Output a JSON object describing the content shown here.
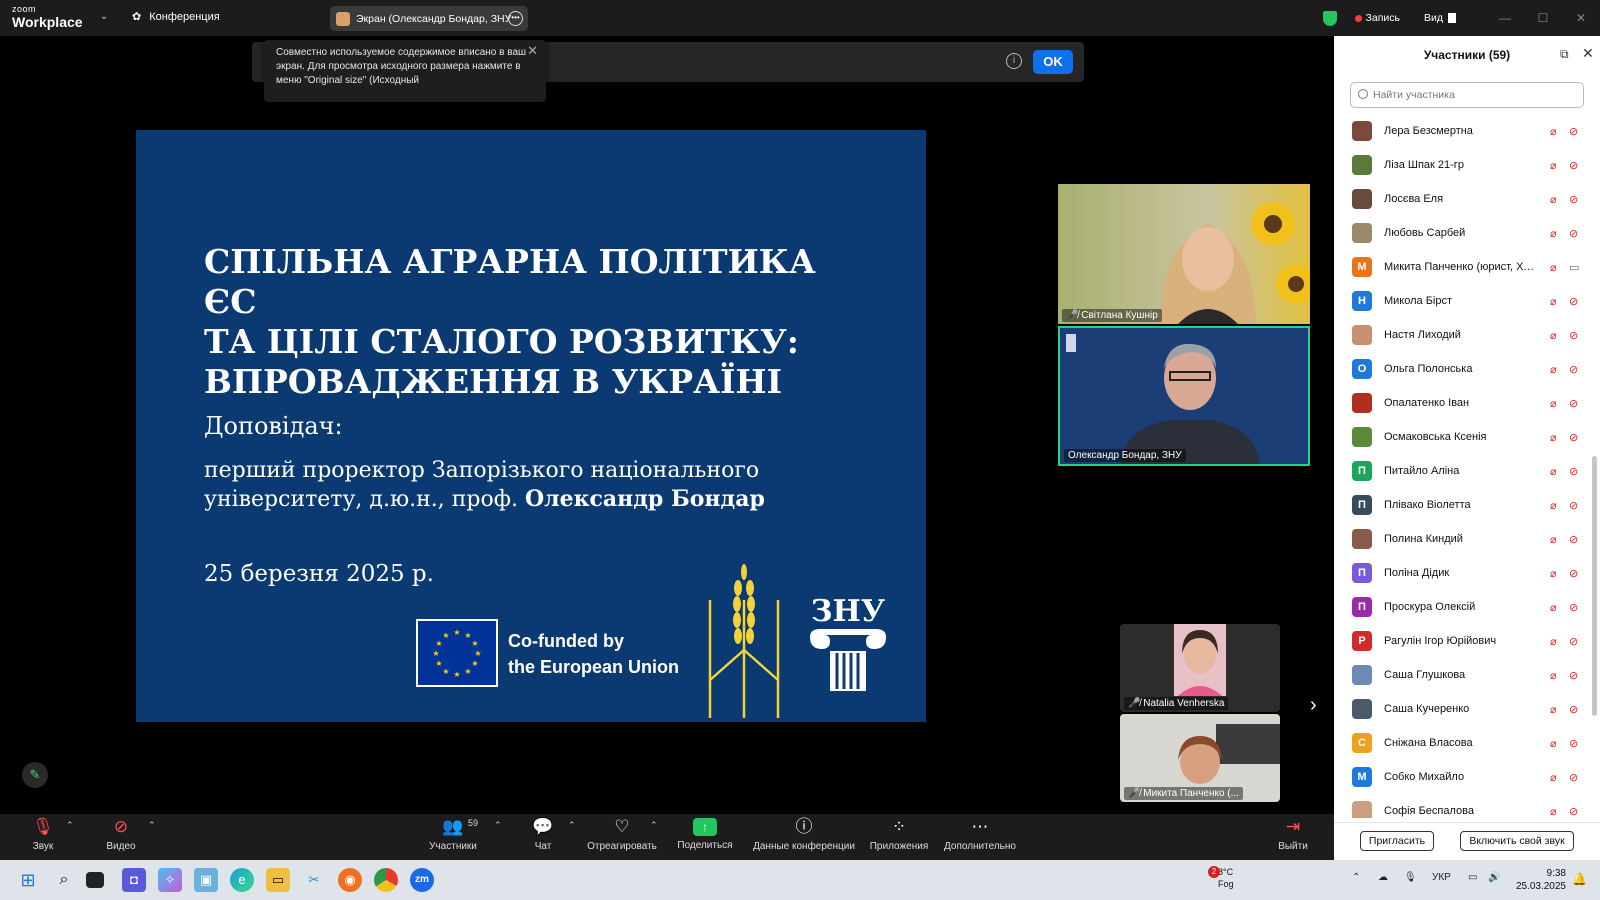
{
  "topbar": {
    "logo_small": "zoom",
    "logo_big": "Workplace",
    "meeting_tab": "Конференция",
    "screen_share_label": "Экран (Олександр Бондар, ЗНУ",
    "record_label": "Запись",
    "view_label": "Вид"
  },
  "notice": {
    "tooltip_text": "Совместно используемое содержимое вписано в ваш экран. Для просмотра исходного размера нажмите в меню \"Original size\" (Исходный",
    "ok_label": "OK"
  },
  "slide": {
    "title_lines": [
      "СПІЛЬНА АГРАРНА ПОЛІТИКА ЄС",
      "ТА ЦІЛІ СТАЛОГО РОЗВИТКУ:",
      "ВПРОВАДЖЕННЯ В УКРАЇНІ"
    ],
    "speaker_label": "Доповідач:",
    "speaker_line1": "перший проректор Запорізького національного",
    "speaker_line2_prefix": "університету, д.ю.н., проф. ",
    "speaker_name": "Олександр Бондар",
    "date": "25 березня 2025 р.",
    "eu_line1": "Co-funded by",
    "eu_line2": "the European Union",
    "znu_text": "ЗНУ"
  },
  "videos": [
    {
      "name": "Світлана Кушнір"
    },
    {
      "name": "Олександр Бондар, ЗНУ"
    },
    {
      "name": "Natalia Venherska"
    },
    {
      "name": "Микита Панченко (..."
    }
  ],
  "panel": {
    "title": "Участники (59)",
    "search_placeholder": "Найти участника",
    "invite_label": "Пригласить",
    "unmute_label": "Включить свой звук",
    "participants": [
      {
        "name": "Лера Безсмертна",
        "initial": "",
        "color": "#7a4a3a",
        "cam_on": false
      },
      {
        "name": "Ліза Шпак 21-гр",
        "initial": "",
        "color": "#5a7a3a",
        "cam_on": false
      },
      {
        "name": "Лосєва Еля",
        "initial": "",
        "color": "#6a4a3a",
        "cam_on": false
      },
      {
        "name": "Любовь Сарбей",
        "initial": "",
        "color": "#9a8a6a",
        "cam_on": false
      },
      {
        "name": "Микита Панченко (юрист, ХО...",
        "initial": "М",
        "color": "#e8741c",
        "cam_on": true
      },
      {
        "name": "Микола Бірст",
        "initial": "Н",
        "color": "#1e7ad8",
        "cam_on": false
      },
      {
        "name": "Настя Лиходий",
        "initial": "",
        "color": "#c89070",
        "cam_on": false
      },
      {
        "name": "Ольга Полонська",
        "initial": "О",
        "color": "#1e7ad8",
        "cam_on": false
      },
      {
        "name": "Опалатенко Іван",
        "initial": "",
        "color": "#b03020",
        "cam_on": false
      },
      {
        "name": "Осмаковська Ксенія",
        "initial": "",
        "color": "#5a8a3a",
        "cam_on": false
      },
      {
        "name": "Питайло Аліна",
        "initial": "П",
        "color": "#1aa55a",
        "cam_on": false
      },
      {
        "name": "Плівако Віолетта",
        "initial": "П",
        "color": "#3a4a5a",
        "cam_on": false
      },
      {
        "name": "Полина Киндий",
        "initial": "",
        "color": "#8a5a4a",
        "cam_on": false
      },
      {
        "name": "Поліна Дідик",
        "initial": "П",
        "color": "#7a5ad8",
        "cam_on": false
      },
      {
        "name": "Проскура Олексій",
        "initial": "П",
        "color": "#9a2aa8",
        "cam_on": false
      },
      {
        "name": "Рагулін Ігор Юрійович",
        "initial": "Р",
        "color": "#d02a2a",
        "cam_on": false
      },
      {
        "name": "Саша Глушкова",
        "initial": "",
        "color": "#6a8ab8",
        "cam_on": false
      },
      {
        "name": "Саша Кучеренко",
        "initial": "",
        "color": "#4a5a6a",
        "cam_on": false
      },
      {
        "name": "Сніжана Власова",
        "initial": "С",
        "color": "#f0a020",
        "cam_on": false
      },
      {
        "name": "Собко Михайло",
        "initial": "М",
        "color": "#1e7ad8",
        "cam_on": false
      },
      {
        "name": "Софія Беспалова",
        "initial": "",
        "color": "#c8a080",
        "cam_on": false
      }
    ]
  },
  "toolbar": {
    "audio": "Звук",
    "video": "Видео",
    "participants": "Участники",
    "participants_count": "59",
    "chat": "Чат",
    "react": "Отреагировать",
    "share": "Поделиться",
    "info": "Данные конференции",
    "apps": "Приложения",
    "more": "Дополнительно",
    "leave": "Выйти"
  },
  "taskbar": {
    "weather_badge": "2",
    "weather_temp": "8°C",
    "weather_desc": "Fog",
    "lang": "УКР",
    "time": "9:38",
    "date": "25.03.2025"
  }
}
